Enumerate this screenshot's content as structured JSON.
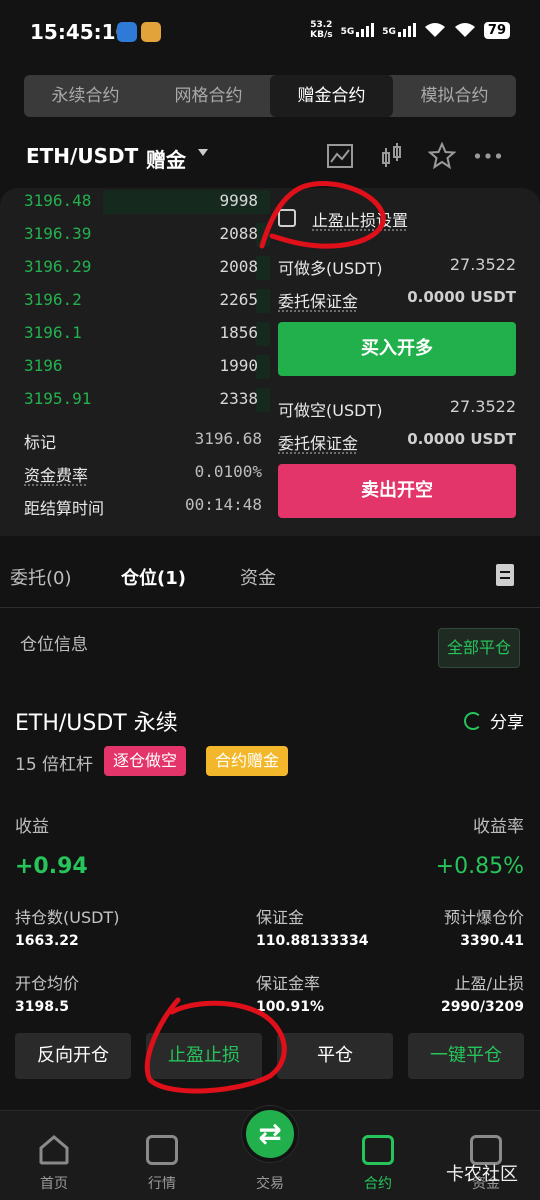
{
  "status": {
    "time": "15:45:10",
    "net_speed_top": "53.2",
    "net_speed_bottom": "KB/s",
    "sig1": "5G",
    "sig2": "5G",
    "battery": "79"
  },
  "top_tabs": [
    {
      "label": "永续合约",
      "active": false
    },
    {
      "label": "网格合约",
      "active": false
    },
    {
      "label": "赠金合约",
      "active": true
    },
    {
      "label": "模拟合约",
      "active": false
    }
  ],
  "pair": {
    "name": "ETH/USDT",
    "mode": "赠金"
  },
  "icons": [
    "chart-icon",
    "candlestick-icon",
    "star-icon",
    "more-icon"
  ],
  "order_book": [
    {
      "price": "3196.48",
      "qty": "9998",
      "depth": 0.62
    },
    {
      "price": "3196.39",
      "qty": "2088",
      "depth": 0.05
    },
    {
      "price": "3196.29",
      "qty": "2008",
      "depth": 0.05
    },
    {
      "price": "3196.2",
      "qty": "2265",
      "depth": 0.05
    },
    {
      "price": "3196.1",
      "qty": "1856",
      "depth": 0.05
    },
    {
      "price": "3196",
      "qty": "1990",
      "depth": 0.05
    },
    {
      "price": "3195.91",
      "qty": "2338",
      "depth": 0.05
    }
  ],
  "market_info": {
    "mark_label": "标记",
    "mark_value": "3196.68",
    "funding_label": "资金费率",
    "funding_value": "0.0100%",
    "settle_label": "距结算时间",
    "settle_value": "00:14:48"
  },
  "form": {
    "tp_sl_label": "止盈止损设置",
    "long_avail_label": "可做多(USDT)",
    "long_avail_value": "27.3522",
    "long_margin_label": "委托保证金",
    "long_margin_value": "0.0000 USDT",
    "buy_label": "买入开多",
    "short_avail_label": "可做空(USDT)",
    "short_avail_value": "27.3522",
    "short_margin_label": "委托保证金",
    "short_margin_value": "0.0000 USDT",
    "sell_label": "卖出开空"
  },
  "order_tabs": {
    "orders": "委托(0)",
    "positions": "仓位(1)",
    "funds": "资金"
  },
  "position_header": {
    "label": "仓位信息",
    "close_all": "全部平仓"
  },
  "position": {
    "title": "ETH/USDT 永续",
    "share": "分享",
    "leverage": "15 倍杠杆",
    "tag_mode": "逐仓做空",
    "tag_bonus": "合约赠金",
    "pnl_label": "收益",
    "pnl_value": "+0.94",
    "roe_label": "收益率",
    "roe_value": "+0.85%",
    "size_label": "持仓数(USDT)",
    "size_value": "1663.22",
    "margin_label": "保证金",
    "margin_value": "110.88133334",
    "liq_label": "预计爆仓价",
    "liq_value": "3390.41",
    "entry_label": "开仓均价",
    "entry_value": "3198.5",
    "margin_ratio_label": "保证金率",
    "margin_ratio_value": "100.91%",
    "tpsl_label": "止盈/止损",
    "tpsl_value": "2990/3209"
  },
  "actions": {
    "reverse": "反向开仓",
    "tpsl": "止盈止损",
    "close": "平仓",
    "quick_close": "一键平仓"
  },
  "nav": [
    {
      "label": "首页",
      "icon": "home-icon",
      "active": false
    },
    {
      "label": "行情",
      "icon": "market-icon",
      "active": false
    },
    {
      "label": "交易",
      "icon": "swap-icon",
      "active": false
    },
    {
      "label": "合约",
      "icon": "contract-icon",
      "active": true
    },
    {
      "label": "资金",
      "icon": "wallet-icon",
      "active": false
    }
  ],
  "watermark": "卡农社区",
  "colors": {
    "green": "#21b04b",
    "red": "#e3356a",
    "yellow": "#f2b72a",
    "annotation": "#e0101a"
  }
}
